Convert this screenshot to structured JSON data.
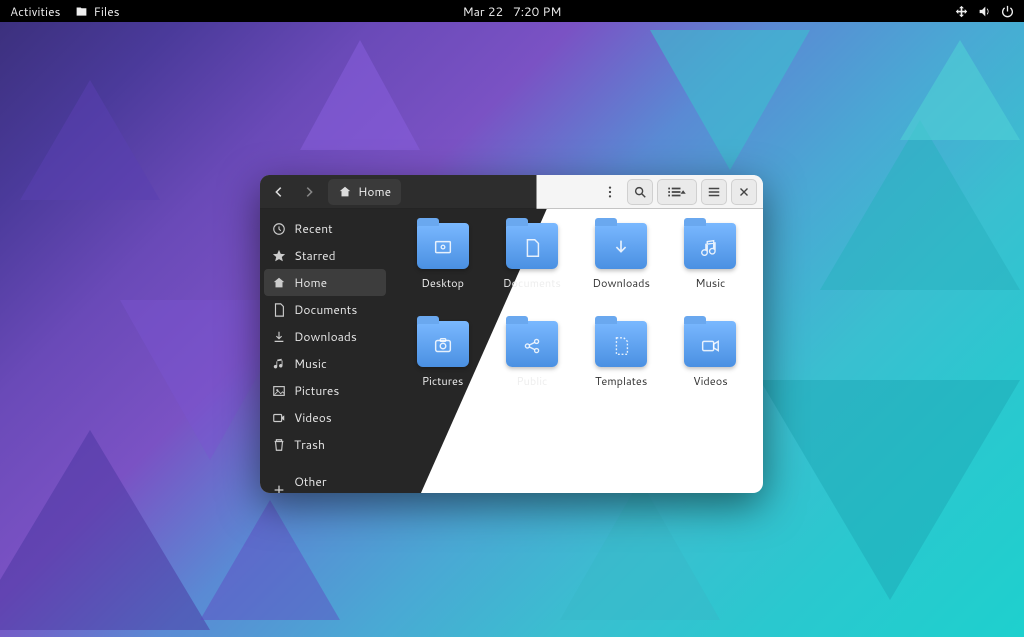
{
  "topbar": {
    "activities": "Activities",
    "app_name": "Files",
    "date": "Mar 22",
    "time": "7:20 PM"
  },
  "window": {
    "path_label": "Home"
  },
  "sidebar": {
    "items": [
      {
        "icon": "clock",
        "label": "Recent"
      },
      {
        "icon": "star",
        "label": "Starred"
      },
      {
        "icon": "home",
        "label": "Home",
        "active": true
      },
      {
        "icon": "doc",
        "label": "Documents"
      },
      {
        "icon": "down",
        "label": "Downloads"
      },
      {
        "icon": "music",
        "label": "Music"
      },
      {
        "icon": "picture",
        "label": "Pictures"
      },
      {
        "icon": "video",
        "label": "Videos"
      },
      {
        "icon": "trash",
        "label": "Trash"
      }
    ],
    "other_locations": "Other Locations"
  },
  "folders": [
    {
      "label": "Desktop",
      "glyph": "desktop",
      "side": "dark"
    },
    {
      "label": "Documents",
      "glyph": "doc",
      "side": "dark"
    },
    {
      "label": "Downloads",
      "glyph": "down",
      "side": "light"
    },
    {
      "label": "Music",
      "glyph": "music",
      "side": "light"
    },
    {
      "label": "Pictures",
      "glyph": "picture",
      "side": "dark"
    },
    {
      "label": "Public",
      "glyph": "share",
      "side": "dark"
    },
    {
      "label": "Templates",
      "glyph": "template",
      "side": "light"
    },
    {
      "label": "Videos",
      "glyph": "video",
      "side": "light"
    }
  ]
}
